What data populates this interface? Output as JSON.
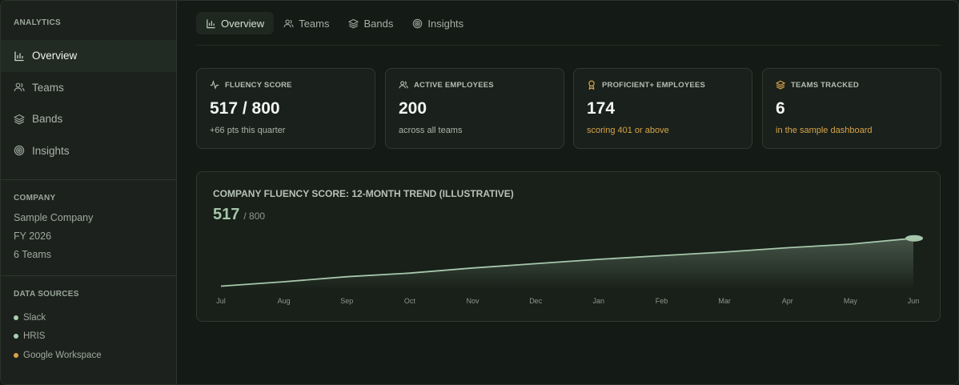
{
  "sidebar": {
    "analytics_header": "ANALYTICS",
    "nav": [
      {
        "label": "Overview",
        "icon": "bar-chart-icon",
        "active": true
      },
      {
        "label": "Teams",
        "icon": "users-icon",
        "active": false
      },
      {
        "label": "Bands",
        "icon": "layers-icon",
        "active": false
      },
      {
        "label": "Insights",
        "icon": "target-icon",
        "active": false
      }
    ],
    "company_header": "COMPANY",
    "company": [
      "Sample Company",
      "FY 2026",
      "6 Teams"
    ],
    "sources_header": "DATA SOURCES",
    "sources": [
      {
        "label": "Slack",
        "color": "#a9d1b0"
      },
      {
        "label": "HRIS",
        "color": "#a9d1b0"
      },
      {
        "label": "Google Workspace",
        "color": "#d8a54a"
      }
    ]
  },
  "tabs": [
    {
      "label": "Overview",
      "icon": "bar-chart-icon",
      "active": true
    },
    {
      "label": "Teams",
      "icon": "users-icon",
      "active": false
    },
    {
      "label": "Bands",
      "icon": "layers-icon",
      "active": false
    },
    {
      "label": "Insights",
      "icon": "target-icon",
      "active": false
    }
  ],
  "kpis": [
    {
      "label": "FLUENCY SCORE",
      "icon": "activity-icon",
      "value": "517 / 800",
      "sub": "+66 pts this quarter",
      "sub_color": "#a9b4aa"
    },
    {
      "label": "ACTIVE EMPLOYEES",
      "icon": "users-icon",
      "value": "200",
      "sub": "across all teams",
      "sub_color": "#a9b4aa"
    },
    {
      "label": "PROFICIENT+ EMPLOYEES",
      "icon": "award-icon",
      "value": "174",
      "sub": "scoring 401 or above",
      "sub_color": "#d8a54a"
    },
    {
      "label": "TEAMS TRACKED",
      "icon": "layers-icon",
      "value": "6",
      "sub": "in the sample dashboard",
      "sub_color": "#d8a54a"
    }
  ],
  "trend": {
    "title": "COMPANY FLUENCY SCORE: 12-MONTH TREND (ILLUSTRATIVE)",
    "score": "517",
    "score_max": "/ 800"
  },
  "colors": {
    "accent": "#a4c6a9",
    "warning": "#d8a54a",
    "line": "#a6c7ab"
  },
  "chart_data": {
    "type": "area",
    "title": "COMPANY FLUENCY SCORE: 12-MONTH TREND (ILLUSTRATIVE)",
    "categories": [
      "Jul",
      "Aug",
      "Sep",
      "Oct",
      "Nov",
      "Dec",
      "Jan",
      "Feb",
      "Mar",
      "Apr",
      "May",
      "Jun"
    ],
    "series": [
      {
        "values": [
          451,
          457,
          464,
          469,
          476,
          482,
          488,
          493,
          498,
          504,
          509,
          517
        ]
      }
    ],
    "ylim": [
      446,
      520
    ],
    "grid": false,
    "legend": "none"
  }
}
